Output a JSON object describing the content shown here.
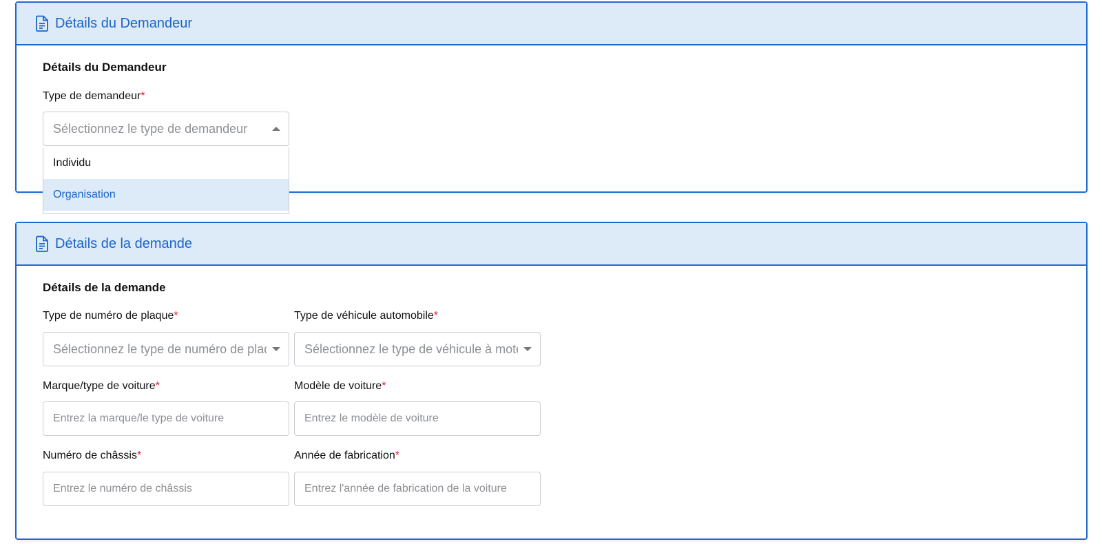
{
  "applicant_panel": {
    "header_title": "Détails du Demandeur",
    "section_title": "Détails du Demandeur",
    "applicant_type": {
      "label": "Type de demandeur",
      "required_mark": "*",
      "placeholder": "Sélectionnez le type de demandeur",
      "options": [
        "Individu",
        "Organisation"
      ],
      "highlighted_option": "Organisation"
    }
  },
  "request_panel": {
    "header_title": "Détails de la demande",
    "section_title": "Détails de la demande",
    "plate_type": {
      "label": "Type de numéro de plaque",
      "required_mark": "*",
      "placeholder": "Sélectionnez le type de numéro de plaque"
    },
    "vehicle_type": {
      "label": "Type de véhicule automobile",
      "required_mark": "*",
      "placeholder": "Sélectionnez le type de véhicule à moteur"
    },
    "car_make": {
      "label": "Marque/type de voiture",
      "required_mark": "*",
      "placeholder": "Entrez la marque/le type de voiture"
    },
    "car_model": {
      "label": "Modèle de voiture",
      "required_mark": "*",
      "placeholder": "Entrez le modèle de voiture"
    },
    "chassis_number": {
      "label": "Numéro de châssis",
      "required_mark": "*",
      "placeholder": "Entrez le numéro de châssis"
    },
    "manufacture_year": {
      "label": "Année de fabrication",
      "required_mark": "*",
      "placeholder": "Entrez l'année de fabrication de la voiture"
    }
  },
  "icons": {
    "panel_header_icon": "document-icon"
  },
  "colors": {
    "accent": "#1f6ad0",
    "header_bg": "#ddebf9",
    "required": "#e0182d"
  }
}
